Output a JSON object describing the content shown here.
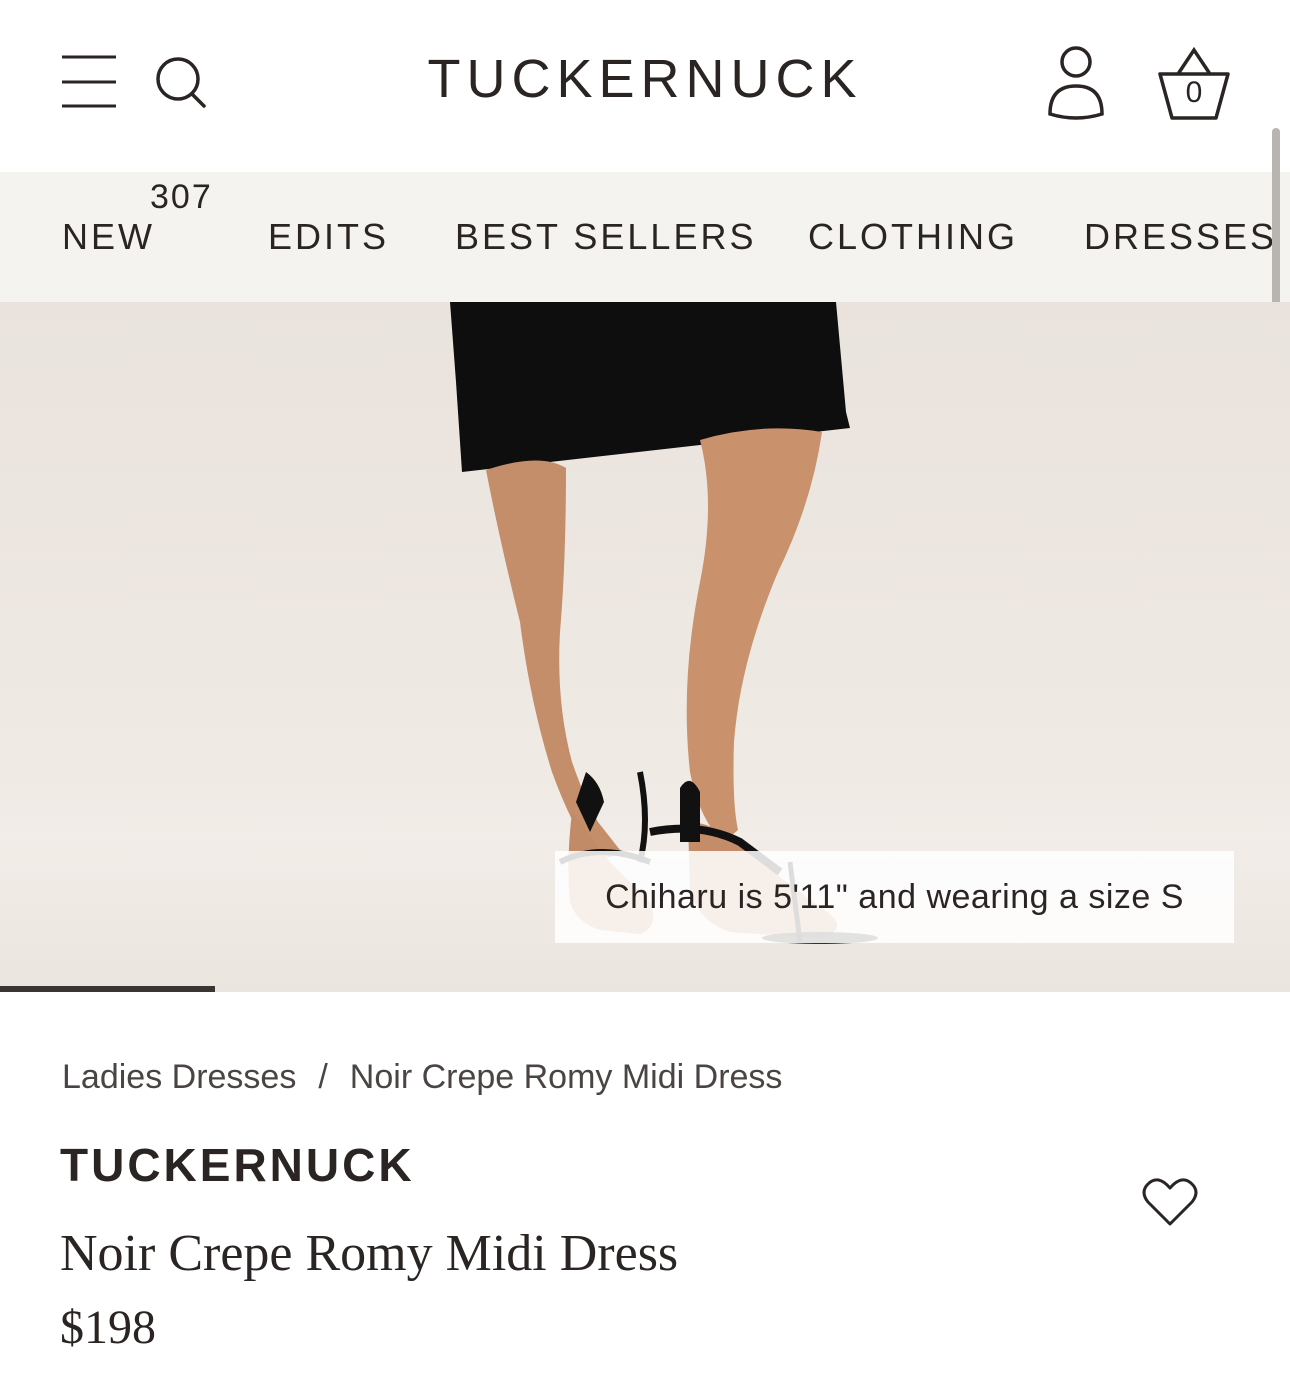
{
  "header": {
    "logo": "TUCKERNUCK",
    "cart_count": "0",
    "icons": [
      "menu-icon",
      "search-icon",
      "account-icon",
      "cart-icon"
    ]
  },
  "nav": {
    "items": [
      {
        "label": "NEW",
        "badge": "307"
      },
      {
        "label": "EDITS"
      },
      {
        "label": "BEST SELLERS"
      },
      {
        "label": "CLOTHING"
      },
      {
        "label": "DRESSES"
      }
    ]
  },
  "hero": {
    "caption": "Chiharu is 5'11\" and wearing a size S",
    "gallery_progress": 0.167
  },
  "product": {
    "breadcrumb": [
      "Ladies Dresses",
      "/",
      "Noir Crepe Romy Midi Dress"
    ],
    "brand": "TUCKERNUCK",
    "title": "Noir Crepe Romy Midi Dress",
    "price": "$198"
  },
  "colors": {
    "text": "#2a2522",
    "nav_bg": "#f4f3ef",
    "dress": "#0f0e0e"
  }
}
